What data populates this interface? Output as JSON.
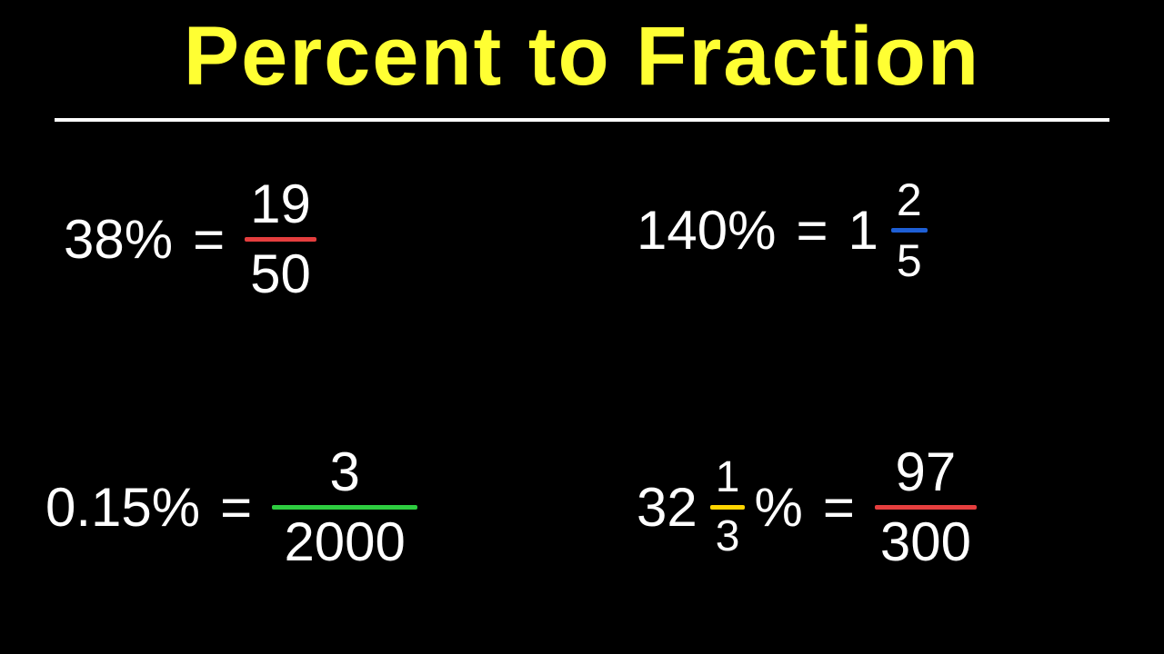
{
  "title": "Percent to Fraction",
  "eq1": {
    "left": "38%",
    "frac": {
      "num": "19",
      "den": "50",
      "bar_color": "red"
    }
  },
  "eq2": {
    "left": "140%",
    "mixed": {
      "whole": "1",
      "num": "2",
      "den": "5",
      "bar_color": "blue"
    }
  },
  "eq3": {
    "left": "0.15%",
    "frac": {
      "num": "3",
      "den": "2000",
      "bar_color": "green"
    }
  },
  "eq4": {
    "left_whole": "32",
    "left_frac": {
      "num": "1",
      "den": "3",
      "bar_color": "yellow"
    },
    "left_suffix": "%",
    "frac": {
      "num": "97",
      "den": "300",
      "bar_color": "red"
    }
  },
  "equals": "="
}
